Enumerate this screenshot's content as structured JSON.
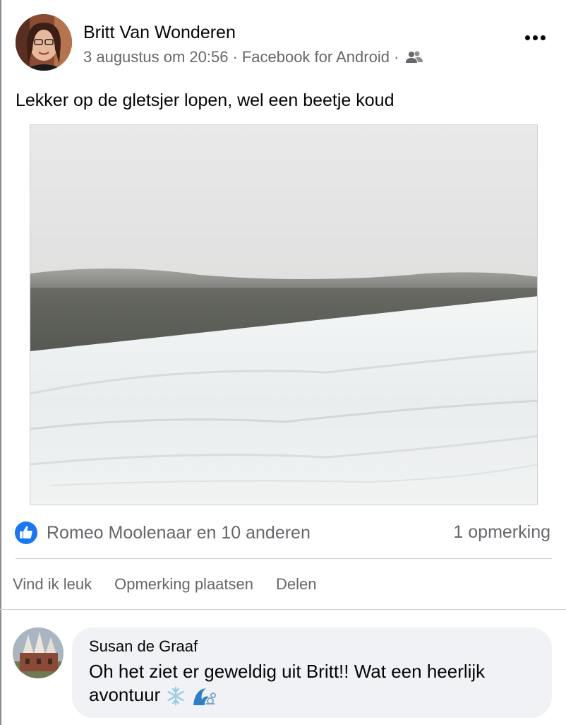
{
  "post": {
    "author": "Britt Van Wonderen",
    "date": "3 augustus om 20:56",
    "separator": "·",
    "source": "Facebook for Android",
    "audience_icon": "friends-icon",
    "text": "Lekker op de gletsjer lopen, wel een beetje koud",
    "more_icon": "more-options-icon"
  },
  "reactions": {
    "icon": "like-icon",
    "label": "Romeo Moolenaar en 10 anderen",
    "comments_count": "1 opmerking"
  },
  "actions": {
    "like": "Vind ik leuk",
    "comment": "Opmerking plaatsen",
    "share": "Delen"
  },
  "comment": {
    "author": "Susan de Graaf",
    "text": "Oh het ziet er geweldig uit Britt!! Wat een heerlijk avontuur",
    "emoji": [
      "snowflake-icon",
      "wind-wave-icon"
    ]
  },
  "colors": {
    "like_blue": "#1877f2",
    "secondary_text": "#65676b",
    "bubble_bg": "#f0f2f5"
  }
}
